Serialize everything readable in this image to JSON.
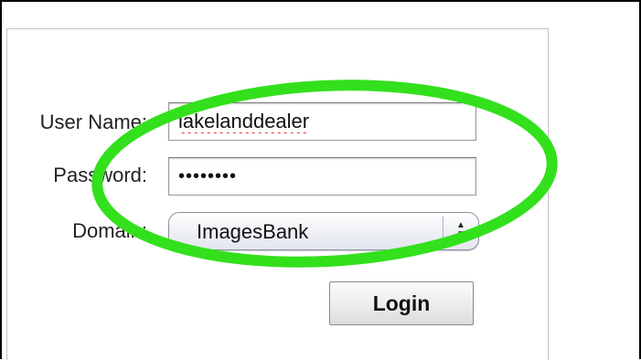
{
  "login_form": {
    "username_label": "User Name:",
    "username_value": "lakelanddealer",
    "password_label": "Password:",
    "password_value": "••••••••",
    "domain_label": "Domain:",
    "domain_value": "ImagesBank",
    "login_button_label": "Login"
  },
  "annotation": {
    "shape": "ellipse",
    "color": "#33e01c"
  },
  "icons": {
    "select_arrows": "updown-arrows-icon"
  }
}
